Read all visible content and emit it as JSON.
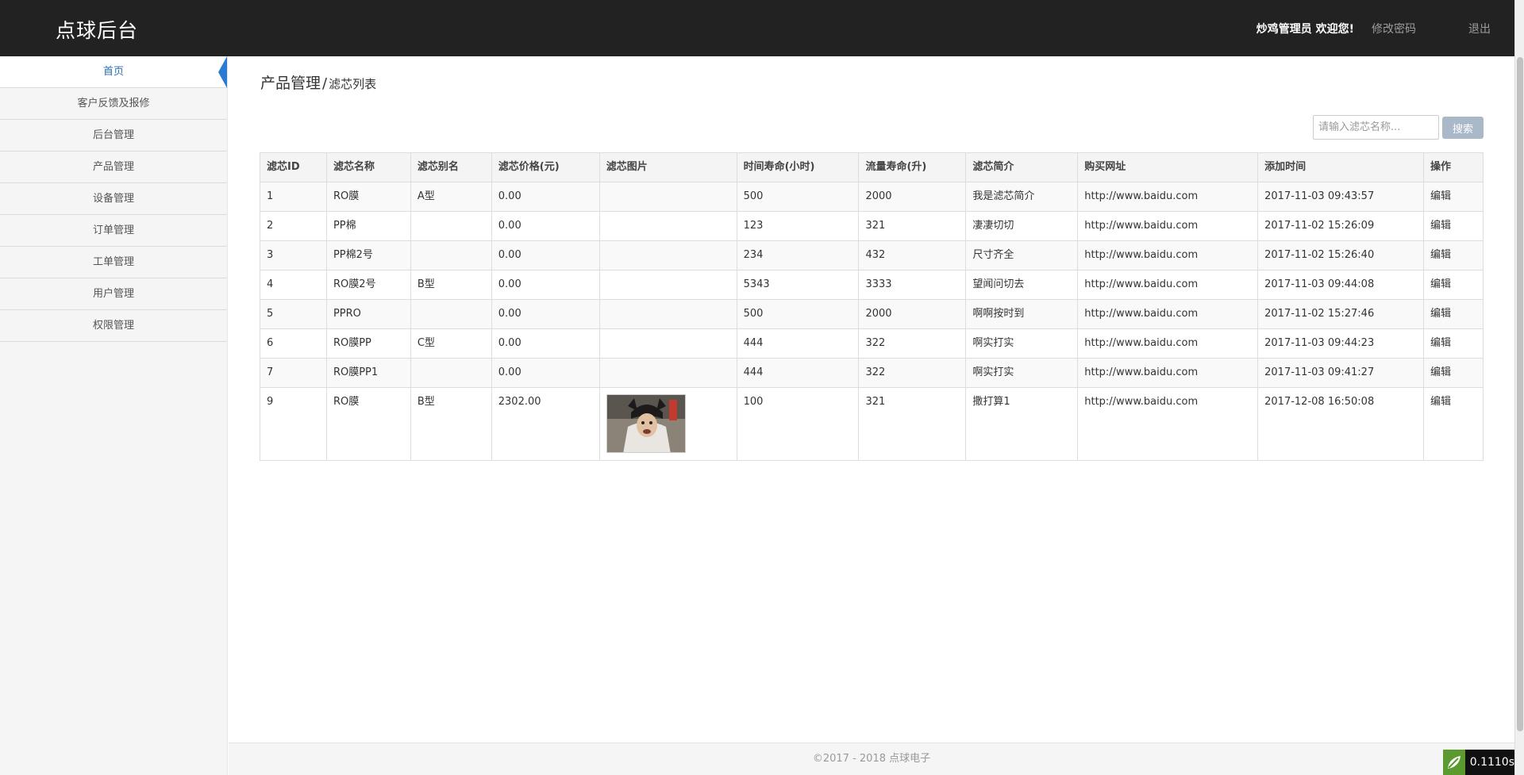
{
  "header": {
    "brand": "点球后台",
    "welcome": "炒鸡管理员 欢迎您!",
    "change_password": "修改密码",
    "logout": "退出"
  },
  "sidebar": {
    "items": [
      {
        "label": "首页",
        "active": true
      },
      {
        "label": "客户反馈及报修"
      },
      {
        "label": "后台管理"
      },
      {
        "label": "产品管理"
      },
      {
        "label": "设备管理"
      },
      {
        "label": "订单管理"
      },
      {
        "label": "工单管理"
      },
      {
        "label": "用户管理"
      },
      {
        "label": "权限管理"
      }
    ]
  },
  "breadcrumb": {
    "section": "产品管理",
    "separator": "/",
    "page": "滤芯列表"
  },
  "search": {
    "placeholder": "请输入滤芯名称...",
    "value": "",
    "button": "搜索"
  },
  "table": {
    "headers": [
      "滤芯ID",
      "滤芯名称",
      "滤芯别名",
      "滤芯价格(元)",
      "滤芯图片",
      "时间寿命(小时)",
      "流量寿命(升)",
      "滤芯简介",
      "购买网址",
      "添加时间",
      "操作"
    ],
    "rows": [
      {
        "id": "1",
        "name": "RO膜",
        "alias": "A型",
        "price": "0.00",
        "image": "",
        "time_life": "500",
        "flow_life": "2000",
        "intro": "我是滤芯简介",
        "url": "http://www.baidu.com",
        "added": "2017-11-03 09:43:57",
        "action": "编辑"
      },
      {
        "id": "2",
        "name": "PP棉",
        "alias": "",
        "price": "0.00",
        "image": "",
        "time_life": "123",
        "flow_life": "321",
        "intro": "凄凄切切",
        "url": "http://www.baidu.com",
        "added": "2017-11-02 15:26:09",
        "action": "编辑"
      },
      {
        "id": "3",
        "name": "PP棉2号",
        "alias": "",
        "price": "0.00",
        "image": "",
        "time_life": "234",
        "flow_life": "432",
        "intro": "尺寸齐全",
        "url": "http://www.baidu.com",
        "added": "2017-11-02 15:26:40",
        "action": "编辑"
      },
      {
        "id": "4",
        "name": "RO膜2号",
        "alias": "B型",
        "price": "0.00",
        "image": "",
        "time_life": "5343",
        "flow_life": "3333",
        "intro": "望闻问切去",
        "url": "http://www.baidu.com",
        "added": "2017-11-03 09:44:08",
        "action": "编辑"
      },
      {
        "id": "5",
        "name": "PPRO",
        "alias": "",
        "price": "0.00",
        "image": "",
        "time_life": "500",
        "flow_life": "2000",
        "intro": "啊啊按时到",
        "url": "http://www.baidu.com",
        "added": "2017-11-02 15:27:46",
        "action": "编辑"
      },
      {
        "id": "6",
        "name": "RO膜PP",
        "alias": "C型",
        "price": "0.00",
        "image": "",
        "time_life": "444",
        "flow_life": "322",
        "intro": "啊实打实",
        "url": "http://www.baidu.com",
        "added": "2017-11-03 09:44:23",
        "action": "编辑"
      },
      {
        "id": "7",
        "name": "RO膜PP1",
        "alias": "",
        "price": "0.00",
        "image": "",
        "time_life": "444",
        "flow_life": "322",
        "intro": "啊实打实",
        "url": "http://www.baidu.com",
        "added": "2017-11-03 09:41:27",
        "action": "编辑"
      },
      {
        "id": "9",
        "name": "RO膜",
        "alias": "B型",
        "price": "2302.00",
        "image": "filter-photo",
        "time_life": "100",
        "flow_life": "321",
        "intro": "撒打算1",
        "url": "http://www.baidu.com",
        "added": "2017-12-08 16:50:08",
        "action": "编辑"
      }
    ]
  },
  "footer": {
    "copyright": "©2017 - 2018 点球电子"
  },
  "debug_badge": {
    "time": "0.1110s"
  },
  "colors": {
    "topbar": "#222222",
    "sidebar_bg": "#f5f5f5",
    "active_link": "#2a6fb5",
    "active_marker": "#2d7ad3",
    "search_button": "#a9b9c9"
  }
}
